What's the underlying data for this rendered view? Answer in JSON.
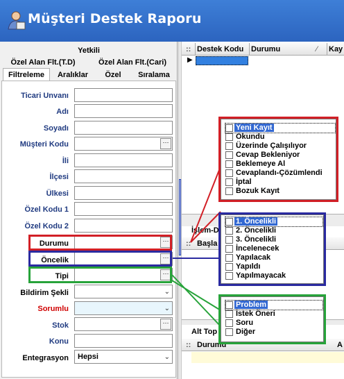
{
  "window": {
    "title": "Müşteri Destek Raporu"
  },
  "tabs_row1": [
    "Yetkili"
  ],
  "tabs_row2": [
    "Özel Alan Flt.(T.D)",
    "Özel Alan Flt.(Cari)"
  ],
  "tabs_row3": [
    "Filtreleme",
    "Aralıklar",
    "Özel",
    "Sıralama"
  ],
  "fields": [
    {
      "label": "Ticari Unvanı"
    },
    {
      "label": "Adı"
    },
    {
      "label": "Soyadı"
    },
    {
      "label": "Müşteri Kodu"
    },
    {
      "label": "İli"
    },
    {
      "label": "İlçesi"
    },
    {
      "label": "Ülkesi"
    },
    {
      "label": "Özel Kodu 1"
    },
    {
      "label": "Özel Kodu 2"
    },
    {
      "label": "Durumu"
    },
    {
      "label": "Öncelik"
    },
    {
      "label": "Tipi"
    },
    {
      "label": "Bildirim Şekli"
    },
    {
      "label": "Sorumlu"
    },
    {
      "label": "Stok"
    },
    {
      "label": "Konu"
    },
    {
      "label": "Entegrasyon",
      "value": "Hepsi"
    }
  ],
  "grid": {
    "headers": [
      "Destek Kodu",
      "Durumu",
      "Kay"
    ],
    "islem_label": "İşlem-D",
    "basla_label": "Başla",
    "alt_label": "Alt Top",
    "bottom_headers": [
      "Durumu",
      "A"
    ]
  },
  "popups": {
    "durumu": [
      "Yeni Kayıt",
      "Okundu",
      "Üzerinde Çalışılıyor",
      "Cevap Bekleniyor",
      "Beklemeye Al",
      "Cevaplandı-Çözümlendi",
      "İptal",
      "Bozuk Kayıt"
    ],
    "oncelik": [
      "1. Öncelikli",
      "2. Öncelikli",
      "3. Öncelikli",
      "İncelenecek",
      "Yapılacak",
      "Yapıldı",
      "Yapılmayacak"
    ],
    "tipi": [
      "Problem",
      "İstek Öneri",
      "Soru",
      "Diğer"
    ]
  },
  "colors": {
    "titlebar": "#2c64bf",
    "red": "#d21f26",
    "navy": "#2a2aa0",
    "green": "#27a33a",
    "label": "#1f3a80"
  }
}
